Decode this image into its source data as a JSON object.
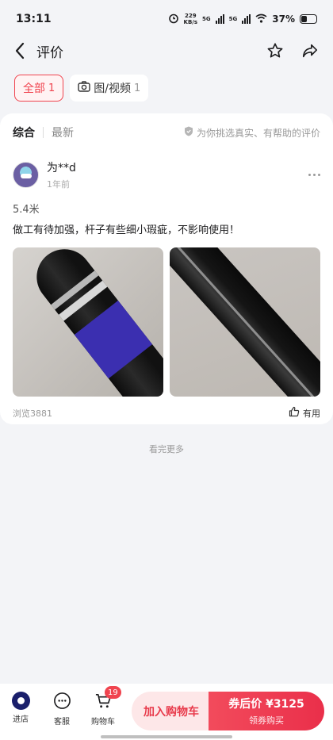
{
  "status_bar": {
    "time": "13:11",
    "speed": "229",
    "speed_unit": "KB/s",
    "net1": "5G",
    "net2": "5G",
    "battery": "37%"
  },
  "header": {
    "title": "评价"
  },
  "filters": [
    {
      "label": "全部",
      "count": "1"
    },
    {
      "label": "图/视频",
      "count": "1"
    }
  ],
  "sort": {
    "comprehensive": "综合",
    "latest": "最新",
    "notice": "为你挑选真实、有帮助的评价"
  },
  "review": {
    "user": "为**d",
    "time": "1年前",
    "spec": "5.4米",
    "content": "做工有待加强，杆子有些细小瑕疵，不影响使用！",
    "views": "浏览3881",
    "useful": "有用"
  },
  "load_more": "看完更多",
  "bottom_bar": {
    "store": "进店",
    "service": "客服",
    "cart": "购物车",
    "cart_count": "19",
    "add_to_cart": "加入购物车",
    "buy_price": "券后价 ¥3125",
    "buy_sub": "领券购买"
  },
  "colors": {
    "accent": "#f0444f",
    "background": "#f3f4f7"
  }
}
